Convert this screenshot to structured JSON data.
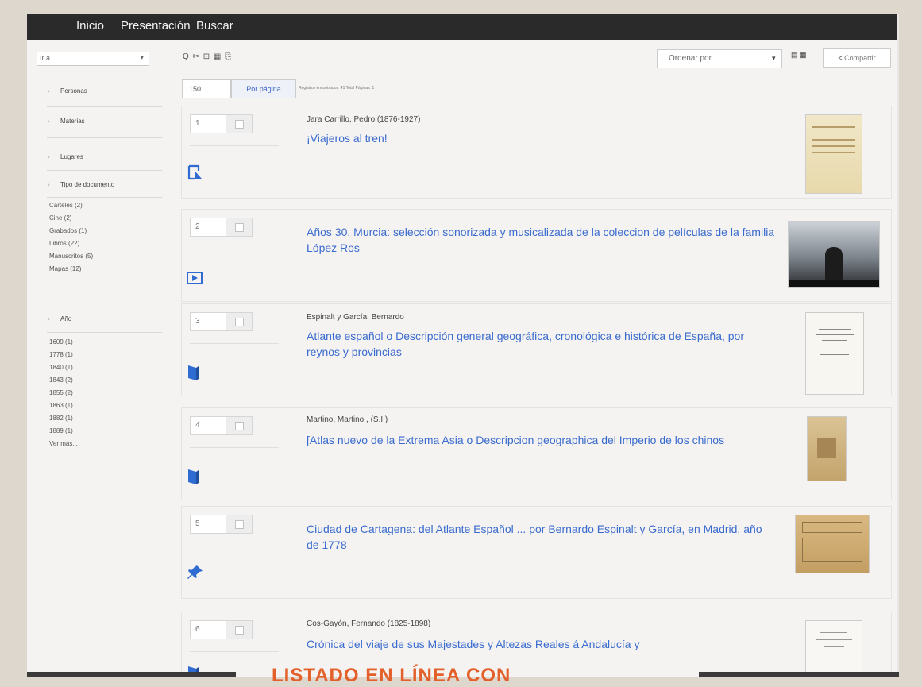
{
  "nav": {
    "items": [
      "Inicio",
      "Presentación",
      "Buscar"
    ]
  },
  "sidebar": {
    "select_value": "Ir a",
    "facets": {
      "personas": "Personas",
      "materias": "Materias",
      "lugares": "Lugares",
      "tipo": "Tipo de documento",
      "ano": "Año"
    },
    "tipo_items": [
      "Carteles (2)",
      "Cine (2)",
      "Grabados (1)",
      "Libros (22)",
      "Manuscritos (5)",
      "Mapas (12)"
    ],
    "ano_items": [
      "1609 (1)",
      "1778 (1)",
      "1840 (1)",
      "1843 (2)",
      "1855 (2)",
      "1863 (1)",
      "1882 (1)",
      "1889 (1)"
    ],
    "ver_mas": "Ver más..."
  },
  "toolbar": {
    "icons": "Q ✂ ⊡ ▦ ⎘",
    "per_page_value": "150",
    "per_page_button": "Por página",
    "registros": "Registros encontrados: 41 Total Páginas: 1",
    "order_placeholder": "Ordenar por",
    "share_label": "Compartir"
  },
  "records": [
    {
      "num": "1",
      "author": "Jara Carrillo, Pedro (1876-1927)",
      "title": "¡Viajeros al tren!",
      "type_icon": "manuscript-icon"
    },
    {
      "num": "2",
      "author": "",
      "title": "Años 30. Murcia: selección sonorizada y musicalizada de la coleccion de películas de la familia López Ros",
      "type_icon": "video-icon"
    },
    {
      "num": "3",
      "author": "Espinalt y García, Bernardo",
      "title": "Atlante español o Descripción general geográfica, cronológica e histórica de España, por reynos y provincias",
      "type_icon": "book-icon"
    },
    {
      "num": "4",
      "author": "Martino, Martino , (S.I.)",
      "title": "[Atlas nuevo de la Extrema Asia o Descripcion geographica del Imperio de los chinos",
      "type_icon": "book-icon"
    },
    {
      "num": "5",
      "author": "",
      "title": "Ciudad de Cartagena: del Atlante Español ... por Bernardo Espinalt y García, en Madrid, año de 1778",
      "type_icon": "map-pin-icon"
    },
    {
      "num": "6",
      "author": "Cos-Gayón, Fernando (1825-1898)",
      "title": "Crónica del viaje de sus Majestades y Altezas Reales á Andalucía y",
      "type_icon": "book-icon"
    }
  ],
  "caption": "LISTADO EN LÍNEA CON",
  "colors": {
    "accent_link": "#3a6bcf",
    "topbar": "#2a2a2a",
    "caption": "#e3602a"
  }
}
